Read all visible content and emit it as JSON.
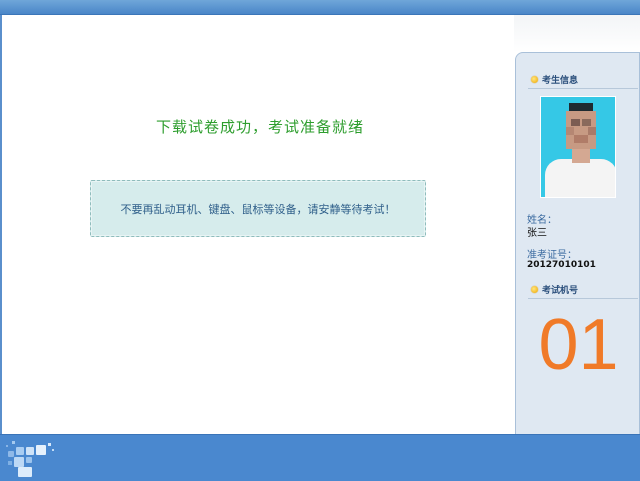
{
  "main": {
    "status_title": "下载试卷成功，考试准备就绪",
    "notice": "不要再乱动耳机、键盘、鼠标等设备，请安静等待考试！"
  },
  "sidebar": {
    "candidate_section": "考生信息",
    "name_label": "姓名：",
    "name_value": "张三",
    "ticket_label": "准考证号：",
    "ticket_value": "20127010101",
    "machine_section": "考试机号",
    "machine_number": "01"
  },
  "icons": {
    "section_bullet": "gold-dot-icon",
    "logo": "squares-logo-icon"
  },
  "colors": {
    "status_title": "#2e9e2e",
    "machine_number": "#f07a28",
    "frame_blue": "#4a88cf",
    "sidebar_bg": "#dfe8f2"
  }
}
